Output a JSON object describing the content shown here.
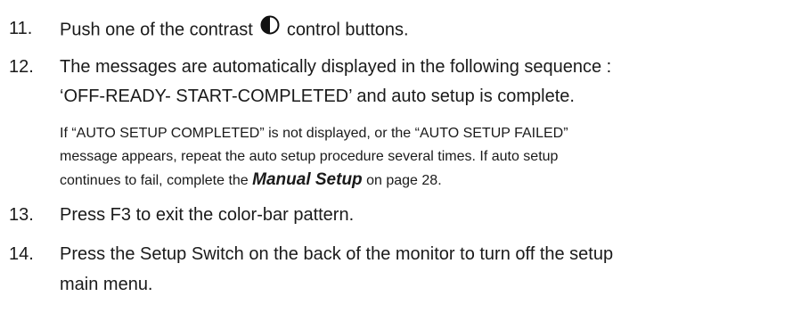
{
  "steps": [
    {
      "number": "11.",
      "text_before_icon": "Push one of the contrast",
      "icon": "contrast-icon",
      "text_after_icon": "control buttons."
    },
    {
      "number": "12.",
      "line1": "The messages are automatically displayed in the following sequence :",
      "line2": "‘OFF-READY- START-COMPLETED’ and auto setup is complete.",
      "note": {
        "line1": "If “AUTO SETUP COMPLETED” is not displayed, or the “AUTO SETUP FAILED”",
        "line2": "message appears, repeat the auto setup procedure several times. If auto setup",
        "line3_before_link": "continues to fail, complete the",
        "link_text": "Manual Setup",
        "line3_after_link": "on page 28."
      }
    },
    {
      "number": "13.",
      "text": "Press F3 to exit the color-bar pattern."
    },
    {
      "number": "14.",
      "line1": "Press the Setup Switch on the back of the monitor to turn off the setup",
      "line2": "main menu."
    }
  ]
}
